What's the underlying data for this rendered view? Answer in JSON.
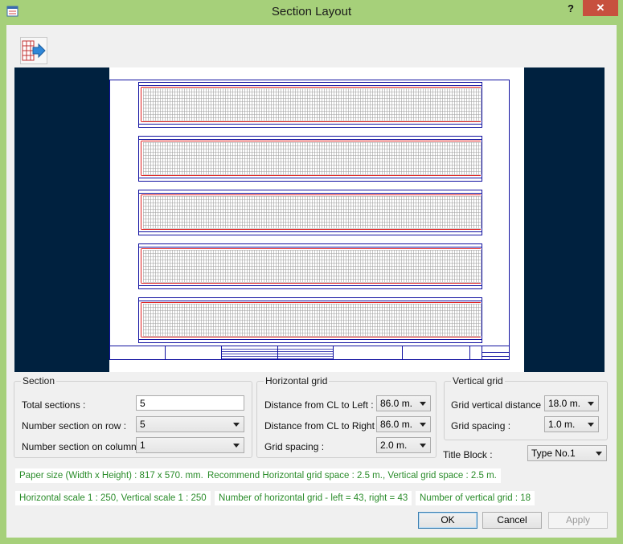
{
  "window": {
    "title": "Section Layout",
    "help_label": "?",
    "close_label": "✕"
  },
  "toolbar": {
    "icon": "grid-arrow-icon"
  },
  "section_group": {
    "title": "Section",
    "total_sections_label": "Total sections :",
    "total_sections_value": "5",
    "row_label": "Number section on row :",
    "row_value": "5",
    "column_label": "Number section on column :",
    "column_value": "1"
  },
  "horizontal_group": {
    "title": "Horizontal grid",
    "left_label": "Distance from CL to Left :",
    "left_value": "86.0 m.",
    "right_label": "Distance from CL to Right :",
    "right_value": "86.0 m.",
    "spacing_label": "Grid spacing :",
    "spacing_value": "2.0 m."
  },
  "vertical_group": {
    "title": "Vertical grid",
    "distance_label": "Grid vertical distance :",
    "distance_value": "18.0 m.",
    "spacing_label": "Grid spacing :",
    "spacing_value": "1.0 m."
  },
  "title_block": {
    "label": "Title Block :",
    "value": "Type No.1"
  },
  "info": {
    "paper_size": "Paper size (Width x Height) : 817 x 570. mm.",
    "recommend": "Recommend Horizontal grid space :  2.5 m., Vertical grid space : 2.5 m.",
    "scale": "Horizontal scale 1 :   250, Vertical scale 1 :   250",
    "horizontal_count": "Number of horizontal grid - left =  43, right =  43",
    "vertical_count": "Number of vertical grid :  18"
  },
  "buttons": {
    "ok": "OK",
    "cancel": "Cancel",
    "apply": "Apply"
  },
  "colors": {
    "frame_blue": "#1010a0",
    "centerline_red": "#e02020",
    "grid_gray": "#a0a0a0",
    "preview_bg": "#00213f",
    "info_green": "#2a8c2a"
  }
}
